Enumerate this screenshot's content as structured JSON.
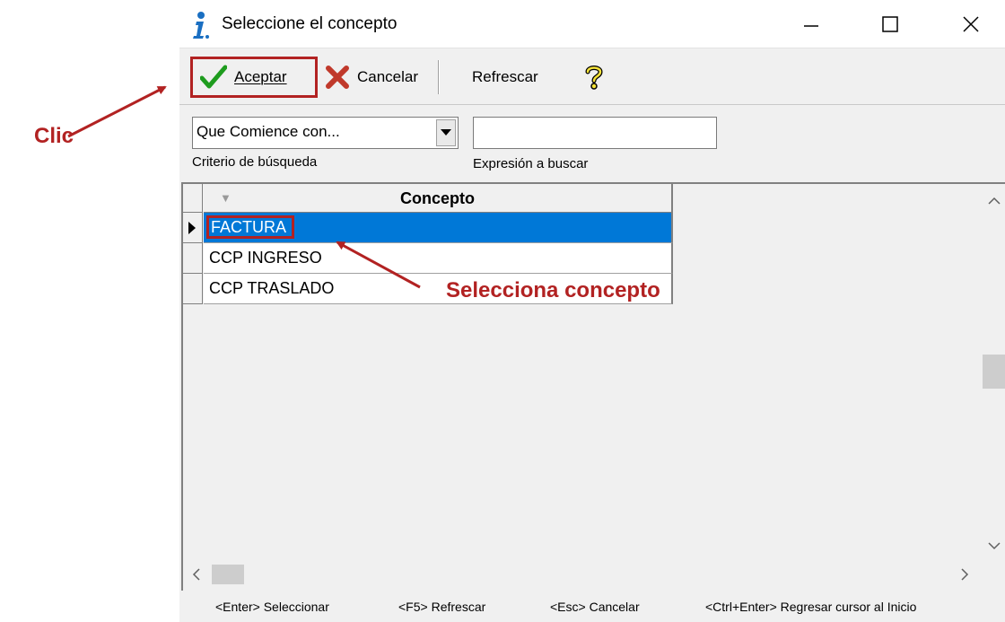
{
  "window": {
    "title": "Seleccione el concepto",
    "controls": {
      "minimize": "minimize-icon",
      "maximize": "maximize-icon",
      "close": "close-icon"
    }
  },
  "toolbar": {
    "aceptar": {
      "label": "Aceptar",
      "hotkey": "A",
      "icon": "checkmark-icon"
    },
    "cancelar": {
      "label": "Cancelar",
      "hotkey": "C",
      "icon": "x-icon"
    },
    "refrescar": {
      "label": "Refrescar",
      "hotkey": "R"
    },
    "help_icon": "help-question-icon"
  },
  "search": {
    "criterio_value": "Que Comience con...",
    "criterio_label": "Criterio de búsqueda",
    "expresion_value": "",
    "expresion_label": "Expresión a buscar"
  },
  "grid": {
    "column": "Concepto",
    "rows": [
      "FACTURA",
      "CCP INGRESO",
      "CCP TRASLADO"
    ],
    "selected_index": 0
  },
  "status": {
    "items": [
      "<Enter> Seleccionar",
      "<F5> Refrescar",
      "<Esc> Cancelar",
      "<Ctrl+Enter> Regresar cursor al Inicio"
    ]
  },
  "annotations": {
    "clic": "Clic",
    "selecciona": "Selecciona concepto"
  },
  "colors": {
    "annotation": "#b22222",
    "selection": "#0078d7",
    "accept_check": "#1e9c1e",
    "cancel_x": "#c0392b"
  }
}
